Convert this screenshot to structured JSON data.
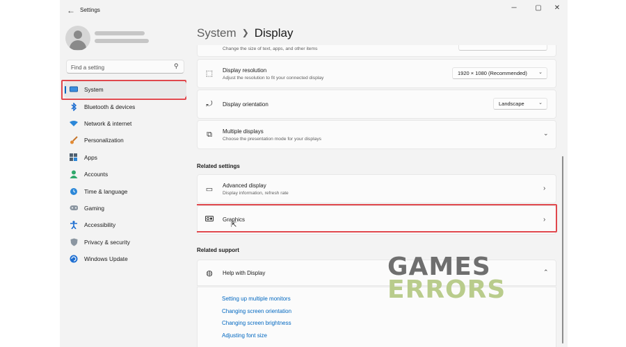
{
  "window": {
    "title": "Settings",
    "controls": {
      "minimize": "─",
      "maximize": "▢",
      "close": "✕"
    }
  },
  "sidebar": {
    "search_placeholder": "Find a setting",
    "items": [
      {
        "label": "System",
        "icon": "display-icon",
        "active": true
      },
      {
        "label": "Bluetooth & devices",
        "icon": "bluetooth-icon"
      },
      {
        "label": "Network & internet",
        "icon": "wifi-icon"
      },
      {
        "label": "Personalization",
        "icon": "brush-icon"
      },
      {
        "label": "Apps",
        "icon": "apps-icon"
      },
      {
        "label": "Accounts",
        "icon": "person-icon"
      },
      {
        "label": "Time & language",
        "icon": "globe-clock-icon"
      },
      {
        "label": "Gaming",
        "icon": "gamepad-icon"
      },
      {
        "label": "Accessibility",
        "icon": "accessibility-icon"
      },
      {
        "label": "Privacy & security",
        "icon": "shield-icon"
      },
      {
        "label": "Windows Update",
        "icon": "update-icon"
      }
    ]
  },
  "breadcrumb": {
    "parent": "System",
    "current": "Display"
  },
  "cards": {
    "scale": {
      "subtitle": "Change the size of text, apps, and other items"
    },
    "resolution": {
      "title": "Display resolution",
      "subtitle": "Adjust the resolution to fit your connected display",
      "value": "1920 × 1080 (Recommended)"
    },
    "orientation": {
      "title": "Display orientation",
      "value": "Landscape"
    },
    "multiple": {
      "title": "Multiple displays",
      "subtitle": "Choose the presentation mode for your displays"
    },
    "advanced": {
      "title": "Advanced display",
      "subtitle": "Display information, refresh rate"
    },
    "graphics": {
      "title": "Graphics"
    },
    "help": {
      "title": "Help with Display"
    }
  },
  "sections": {
    "related_settings": "Related settings",
    "related_support": "Related support"
  },
  "help_links": [
    "Setting up multiple monitors",
    "Changing screen orientation",
    "Changing screen brightness",
    "Adjusting font size"
  ],
  "watermark": {
    "line1": "GAMES",
    "line2": "ERRORS"
  },
  "colors": {
    "accent": "#0067c0",
    "highlight": "#e0474c",
    "watermark_gray": "#6f6f6f",
    "watermark_green": "#b9cc8c"
  }
}
